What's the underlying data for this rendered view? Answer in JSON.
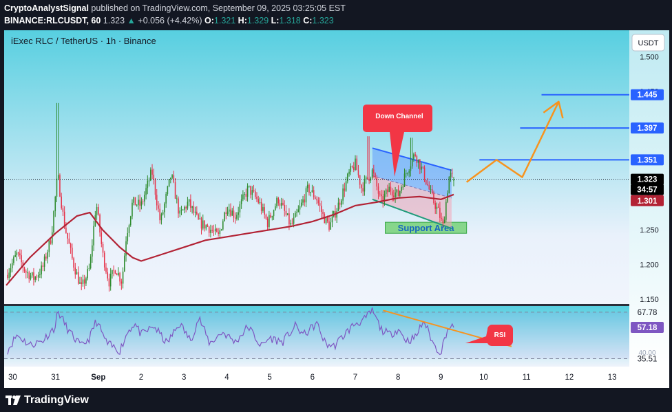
{
  "header": {
    "author": "CryptoAnalystSignal",
    "published_text": "published on TradingView.com, September 09, 2025 03:25:05 EST",
    "symbol": "BINANCE:RLCUSDT, 60",
    "last": "1.323",
    "change_arrow": "▲",
    "change": "+0.056 (+4.42%)",
    "o_label": "O:",
    "o": "1.321",
    "h_label": "H:",
    "h": "1.329",
    "l_label": "L:",
    "l": "1.318",
    "c_label": "C:",
    "c": "1.323"
  },
  "chart_title": "iExec RLC / TetherUS · 1h · Binance",
  "currency_button": "USDT",
  "price_badges": {
    "current": "1.323",
    "countdown": "34:57",
    "ma": "1.301",
    "target1": "1.351",
    "target2": "1.397",
    "target3": "1.445"
  },
  "rsi_badges": {
    "upper": "67.78",
    "value": "57.18",
    "lower": "35.51",
    "mid_hidden": "40.00"
  },
  "annotations": {
    "down_channel": "Down Channel",
    "support_area": "Support Area",
    "rsi": "RSI"
  },
  "colors": {
    "bg_top": "#57cfe0",
    "bg_bottom": "#e9f1fb",
    "bull": "#2e8b2e",
    "bear": "#e5334a",
    "ma": "#b22234",
    "target": "#2962ff",
    "arrow": "#f7931e",
    "rsi_line": "#7e57c2",
    "rsi_badge": "#7e57c2",
    "label_red": "#f23645",
    "support": "#6fcf6f"
  },
  "footer": {
    "brand": "TradingView",
    "logo_icon": "tradingview-logo-icon"
  },
  "chart_data": {
    "type": "candlestick",
    "title": "iExec RLC / TetherUS · 1h · Binance",
    "y_ticks": [
      1.15,
      1.2,
      1.25,
      1.3,
      1.35,
      1.4,
      1.45,
      1.5
    ],
    "ylim": [
      1.143,
      1.538
    ],
    "x_ticks": [
      "30",
      "31",
      "Sep",
      "2",
      "3",
      "4",
      "5",
      "6",
      "7",
      "8",
      "9",
      "10",
      "11",
      "12",
      "13"
    ],
    "x_tick_days": [
      -3,
      -2,
      -1,
      0,
      1,
      2,
      3,
      4,
      5,
      6,
      7,
      8,
      9,
      10,
      11
    ],
    "x_range_days": [
      -3.2,
      11.4
    ],
    "last_data_day": 7.3,
    "ohlc_anchors": [
      [
        -3.15,
        1.185
      ],
      [
        -2.9,
        1.215
      ],
      [
        -2.7,
        1.19
      ],
      [
        -2.5,
        1.18
      ],
      [
        -2.3,
        1.195
      ],
      [
        -2.1,
        1.24
      ],
      [
        -1.95,
        1.33
      ],
      [
        -1.8,
        1.26
      ],
      [
        -1.6,
        1.205
      ],
      [
        -1.4,
        1.165
      ],
      [
        -1.2,
        1.195
      ],
      [
        -1.05,
        1.29
      ],
      [
        -0.9,
        1.215
      ],
      [
        -0.75,
        1.175
      ],
      [
        -0.6,
        1.195
      ],
      [
        -0.45,
        1.175
      ],
      [
        -0.35,
        1.24
      ],
      [
        -0.2,
        1.29
      ],
      [
        0.0,
        1.285
      ],
      [
        0.25,
        1.335
      ],
      [
        0.45,
        1.26
      ],
      [
        0.7,
        1.33
      ],
      [
        0.9,
        1.27
      ],
      [
        1.1,
        1.29
      ],
      [
        1.35,
        1.26
      ],
      [
        1.55,
        1.255
      ],
      [
        1.8,
        1.24
      ],
      [
        2.0,
        1.285
      ],
      [
        2.2,
        1.27
      ],
      [
        2.5,
        1.31
      ],
      [
        2.75,
        1.29
      ],
      [
        2.95,
        1.26
      ],
      [
        3.2,
        1.295
      ],
      [
        3.5,
        1.255
      ],
      [
        3.7,
        1.28
      ],
      [
        3.9,
        1.31
      ],
      [
        4.1,
        1.295
      ],
      [
        4.25,
        1.27
      ],
      [
        4.4,
        1.255
      ],
      [
        4.6,
        1.285
      ],
      [
        4.85,
        1.33
      ],
      [
        5.0,
        1.345
      ],
      [
        5.15,
        1.31
      ],
      [
        5.4,
        1.335
      ],
      [
        5.6,
        1.29
      ],
      [
        5.8,
        1.31
      ],
      [
        6.0,
        1.3
      ],
      [
        6.2,
        1.335
      ],
      [
        6.4,
        1.36
      ],
      [
        6.6,
        1.33
      ],
      [
        6.8,
        1.295
      ],
      [
        6.95,
        1.275
      ],
      [
        7.05,
        1.255
      ],
      [
        7.2,
        1.33
      ],
      [
        7.3,
        1.323
      ]
    ],
    "ma_series": [
      [
        -3.15,
        1.17
      ],
      [
        -2.6,
        1.21
      ],
      [
        -2.0,
        1.245
      ],
      [
        -1.5,
        1.27
      ],
      [
        -1.2,
        1.275
      ],
      [
        -0.9,
        1.25
      ],
      [
        -0.5,
        1.225
      ],
      [
        -0.2,
        1.21
      ],
      [
        0.0,
        1.205
      ],
      [
        0.5,
        1.215
      ],
      [
        1.0,
        1.225
      ],
      [
        1.5,
        1.235
      ],
      [
        2.0,
        1.24
      ],
      [
        2.5,
        1.245
      ],
      [
        3.0,
        1.25
      ],
      [
        3.5,
        1.255
      ],
      [
        4.0,
        1.262
      ],
      [
        4.5,
        1.272
      ],
      [
        5.0,
        1.285
      ],
      [
        5.5,
        1.29
      ],
      [
        6.0,
        1.296
      ],
      [
        6.5,
        1.298
      ],
      [
        7.0,
        1.294
      ],
      [
        7.3,
        1.301
      ]
    ],
    "channel_upper": [
      [
        5.4,
        1.368
      ],
      [
        7.25,
        1.336
      ]
    ],
    "channel_mid": [
      [
        5.4,
        1.328
      ],
      [
        7.25,
        1.296
      ]
    ],
    "channel_lower": [
      [
        5.4,
        1.294
      ],
      [
        7.25,
        1.252
      ]
    ],
    "support_zone": {
      "day_from": 5.7,
      "day_to": 7.6,
      "price_low": 1.245,
      "price_high": 1.261
    },
    "target_levels": [
      {
        "price": 1.351,
        "day_from": 7.9
      },
      {
        "price": 1.397,
        "day_from": 8.85
      },
      {
        "price": 1.445,
        "day_from": 9.35
      }
    ],
    "projection_path": [
      [
        7.6,
        1.319
      ],
      [
        8.3,
        1.351
      ],
      [
        8.9,
        1.326
      ],
      [
        9.75,
        1.435
      ]
    ],
    "rsi": {
      "levels": [
        67.78,
        35.51
      ],
      "mid_level": 40.0,
      "ylim": [
        30,
        72
      ],
      "last": 57.18,
      "anchors": [
        [
          -3.15,
          40
        ],
        [
          -2.9,
          52
        ],
        [
          -2.6,
          45
        ],
        [
          -2.3,
          48
        ],
        [
          -2.0,
          58
        ],
        [
          -1.95,
          69
        ],
        [
          -1.7,
          55
        ],
        [
          -1.4,
          44
        ],
        [
          -1.2,
          50
        ],
        [
          -1.05,
          62
        ],
        [
          -0.8,
          46
        ],
        [
          -0.5,
          41
        ],
        [
          -0.3,
          55
        ],
        [
          -0.15,
          60
        ],
        [
          0.0,
          52
        ],
        [
          0.3,
          58
        ],
        [
          0.6,
          46
        ],
        [
          0.9,
          60
        ],
        [
          1.15,
          48
        ],
        [
          1.35,
          64
        ],
        [
          1.6,
          46
        ],
        [
          1.9,
          54
        ],
        [
          2.2,
          47
        ],
        [
          2.5,
          58
        ],
        [
          2.8,
          44
        ],
        [
          3.0,
          50
        ],
        [
          3.3,
          47
        ],
        [
          3.6,
          58
        ],
        [
          3.8,
          52
        ],
        [
          4.1,
          60
        ],
        [
          4.3,
          46
        ],
        [
          4.5,
          44
        ],
        [
          4.8,
          54
        ],
        [
          5.0,
          60
        ],
        [
          5.2,
          62
        ],
        [
          5.4,
          69
        ],
        [
          5.6,
          56
        ],
        [
          5.8,
          52
        ],
        [
          6.0,
          56
        ],
        [
          6.2,
          48
        ],
        [
          6.4,
          50
        ],
        [
          6.6,
          62
        ],
        [
          6.85,
          44
        ],
        [
          7.0,
          40
        ],
        [
          7.15,
          56
        ],
        [
          7.3,
          57.18
        ]
      ],
      "trendline": [
        [
          5.65,
          69
        ],
        [
          8.65,
          44
        ]
      ]
    }
  }
}
